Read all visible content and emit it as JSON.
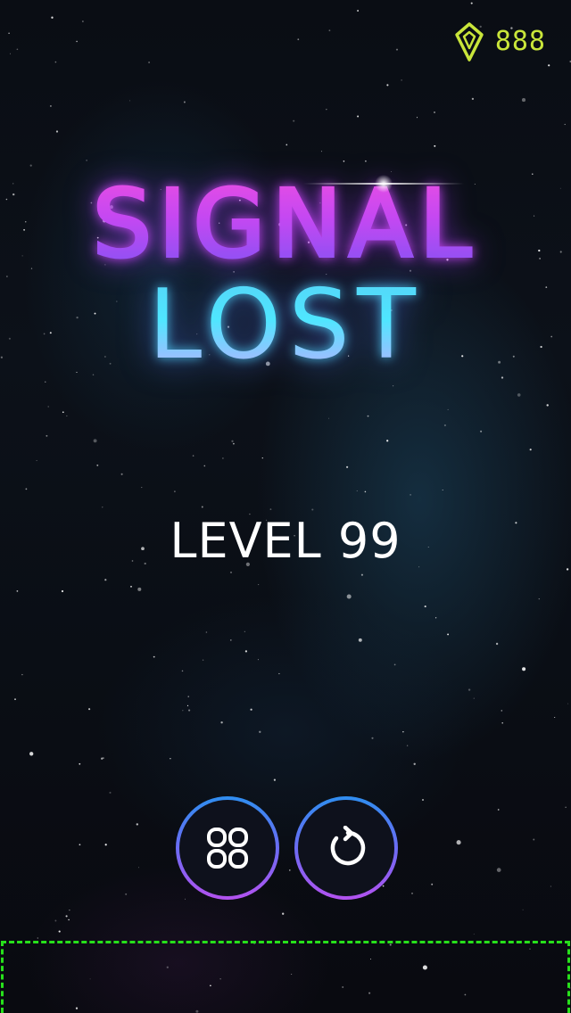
{
  "game": {
    "title_line_1": "SIGNAL",
    "title_line_2": "LOST",
    "level_text": "LEVEL 99"
  },
  "currency": {
    "icon": "gem-icon",
    "value": "888",
    "color": "#c9e53a"
  },
  "buttons": [
    {
      "id": "levels",
      "icon": "grid-icon"
    },
    {
      "id": "restart",
      "icon": "restart-icon"
    }
  ],
  "colors": {
    "title_top": "#f14ee0",
    "title_bottom": "#4fe6ff",
    "button_ring_top": "#2f8ef0",
    "button_ring_bottom": "#b352f0",
    "ad_outline": "#27e01b",
    "background": "#07080d"
  }
}
